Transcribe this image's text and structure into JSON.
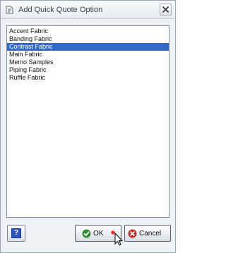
{
  "window": {
    "title": "Add Quick Quote Option",
    "close_icon": "close-icon",
    "app_icon": "app-icon"
  },
  "options_list": {
    "items": [
      {
        "label": "Accent Fabric",
        "selected": false
      },
      {
        "label": "Banding Fabric",
        "selected": false
      },
      {
        "label": "Contrast Fabric",
        "selected": true
      },
      {
        "label": "Main Fabric",
        "selected": false
      },
      {
        "label": "Memo Samples",
        "selected": false
      },
      {
        "label": "Piping Fabric",
        "selected": false
      },
      {
        "label": "Ruffle Fabric",
        "selected": false
      }
    ],
    "selection_color": "#3369c9"
  },
  "buttons": {
    "help_label": "?",
    "ok_label": "OK",
    "cancel_label": "Cancel",
    "ok_icon": "check-icon",
    "cancel_icon": "x-circle-icon"
  },
  "colors": {
    "ok_icon": "#2e8b2e",
    "cancel_icon": "#c62a2a",
    "click_marker": "#e02020"
  }
}
